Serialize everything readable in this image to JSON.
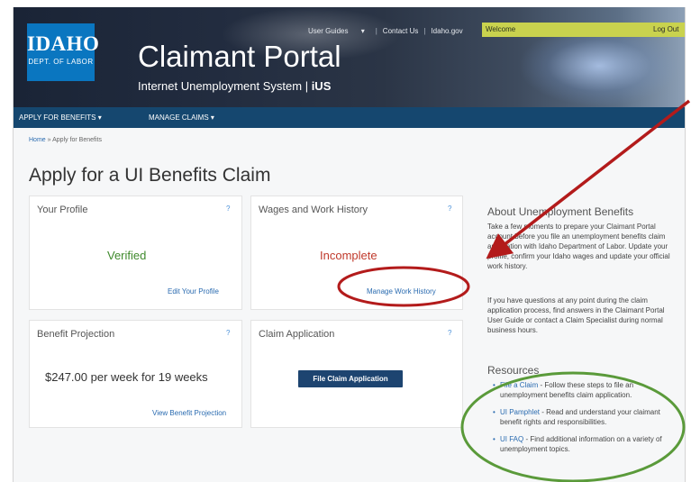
{
  "header": {
    "logo": {
      "line1": "IDAHO",
      "line2": "DEPT. OF LABOR"
    },
    "title": "Claimant Portal",
    "subtitle": "Internet Unemployment System | ",
    "subtitle_logo": "iUS",
    "top_links": {
      "user_guides": "User Guides",
      "contact_us": "Contact Us",
      "idaho_gov": "Idaho.gov",
      "sep": "|"
    },
    "welcome": "Welcome",
    "logout": "Log Out"
  },
  "main_nav": {
    "apply": "APPLY FOR BENEFITS",
    "manage": "MANAGE CLAIMS"
  },
  "breadcrumb": {
    "home": "Home",
    "sep": "»",
    "current": "Apply for Benefits"
  },
  "page_title": "Apply for a UI Benefits Claim",
  "cards": {
    "profile": {
      "title": "Your Profile",
      "help": "?",
      "status": "Verified",
      "link": "Edit Your Profile"
    },
    "wages": {
      "title": "Wages and Work History",
      "help": "?",
      "status": "Incomplete",
      "link": "Manage Work History"
    },
    "projection": {
      "title": "Benefit Projection",
      "help": "?",
      "amount": "$247.00 per week for 19 weeks",
      "link": "View Benefit Projection"
    },
    "claim": {
      "title": "Claim Application",
      "help": "?",
      "button": "File Claim Application"
    }
  },
  "about": {
    "title": "About Unemployment Benefits",
    "p1": "Take a few moments to prepare your Claimant Portal account before you file an unemployment benefits claim application with Idaho Department of Labor. Update your profile, confirm your Idaho wages and update your official work history.",
    "p2": "If you have questions at any point during the claim application process, find answers in the Claimant Portal User Guide or contact a Claim Specialist during normal business hours."
  },
  "resources": {
    "title": "Resources",
    "items": [
      {
        "link": "File a Claim",
        "text": " - Follow these steps to file an unemployment benefits claim application."
      },
      {
        "link": "UI Pamphlet",
        "text": " - Read and understand your claimant benefit rights and responsibilities."
      },
      {
        "link": "UI FAQ",
        "text": " - Find additional information on a variety of unemployment topics."
      }
    ]
  },
  "annotation_colors": {
    "arrow": "#b31b1b",
    "oval_red": "#b31b1b",
    "oval_green": "#5a9a3a"
  }
}
